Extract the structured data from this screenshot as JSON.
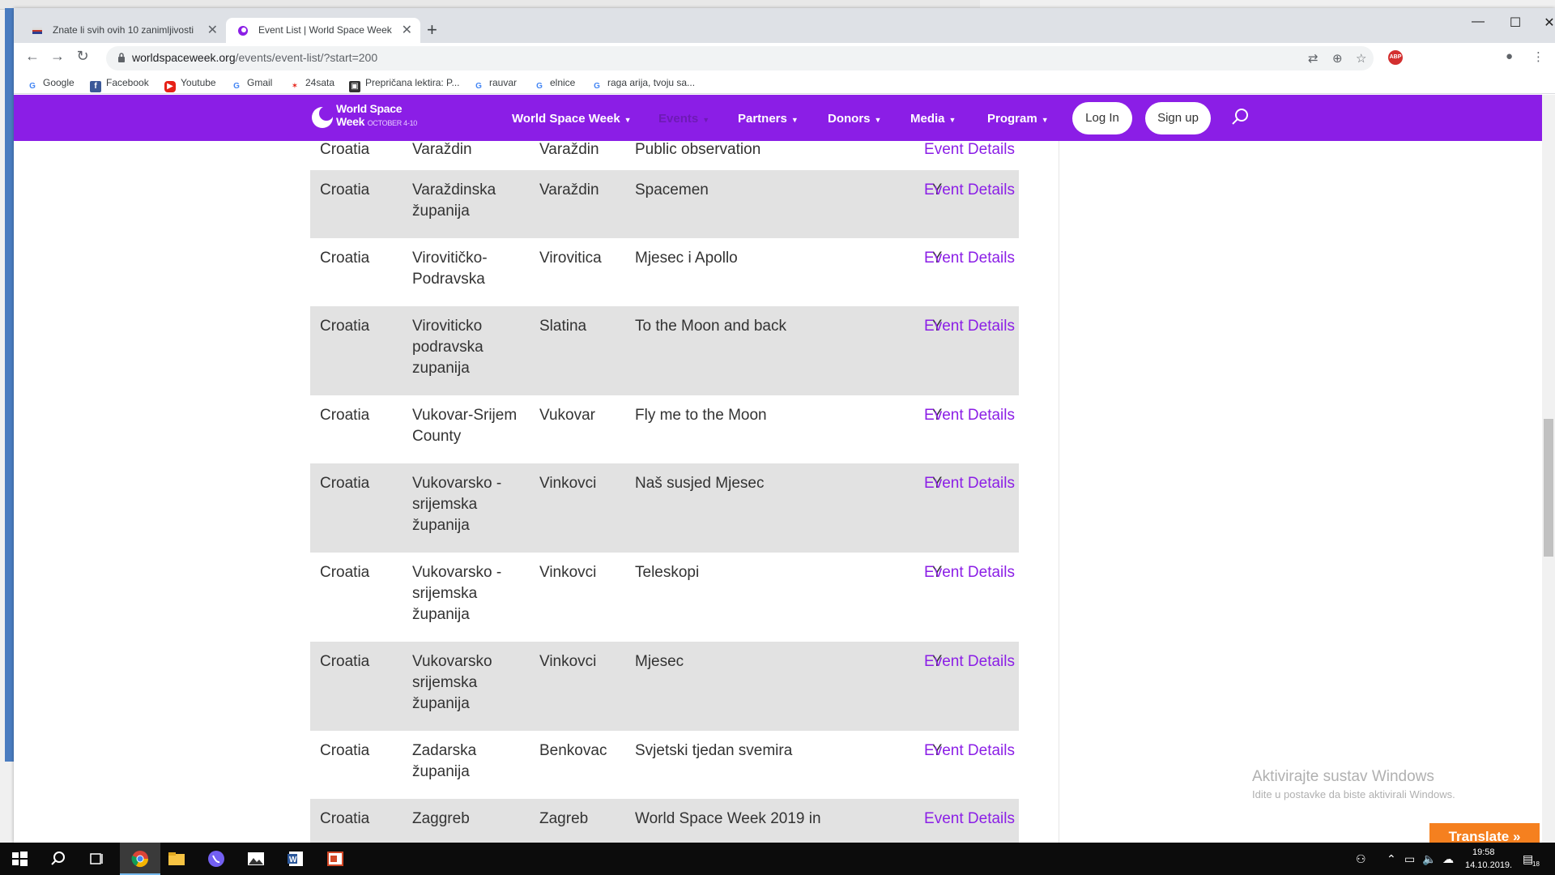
{
  "browser": {
    "tabs": [
      {
        "title": "Znate li svih ovih 10 zanimljivosti",
        "active": false
      },
      {
        "title": "Event List | World Space Week",
        "active": true
      }
    ],
    "url_domain": "worldspaceweek.org",
    "url_path": "/events/event-list/?start=200",
    "bookmarks": [
      {
        "label": "Google",
        "icon": "google-icon"
      },
      {
        "label": "Facebook",
        "icon": "facebook-icon"
      },
      {
        "label": "Youtube",
        "icon": "youtube-icon"
      },
      {
        "label": "Gmail",
        "icon": "google-icon"
      },
      {
        "label": "24sata",
        "icon": "24sata-icon"
      },
      {
        "label": "Prepričana lektira: P...",
        "icon": "book-icon"
      },
      {
        "label": "rauvar",
        "icon": "google-icon"
      },
      {
        "label": "elnice",
        "icon": "google-icon"
      },
      {
        "label": "raga arija, tvoju sa...",
        "icon": "google-icon"
      }
    ]
  },
  "site": {
    "brand_name_line1": "World Space",
    "brand_name_line2": "Week",
    "brand_date": "OCTOBER 4-10",
    "nav": {
      "world_space_week": "World Space Week",
      "events": "Events",
      "partners": "Partners",
      "donors": "Donors",
      "media": "Media",
      "program": "Program"
    },
    "login_label": "Log In",
    "signup_label": "Sign up",
    "brand_color": "#8b1ee6"
  },
  "events": [
    {
      "country": "Croatia",
      "region": "Varaždin",
      "city": "Varaždin",
      "title": "Public observation",
      "flag": "",
      "link": "Event Details"
    },
    {
      "country": "Croatia",
      "region": "Varaždinska županija",
      "city": "Varaždin",
      "title": "Spacemen",
      "flag": "Y",
      "link": "Event Details"
    },
    {
      "country": "Croatia",
      "region": "Virovitičko-Podravska",
      "city": "Virovitica",
      "title": "Mjesec i Apollo",
      "flag": "Y",
      "link": "Event Details"
    },
    {
      "country": "Croatia",
      "region": "Viroviticko podravska zupanija",
      "city": "Slatina",
      "title": "To the Moon and back",
      "flag": "Y",
      "link": "Event Details"
    },
    {
      "country": "Croatia",
      "region": "Vukovar-Srijem County",
      "city": "Vukovar",
      "title": "Fly me to the Moon",
      "flag": "Y",
      "link": "Event Details"
    },
    {
      "country": "Croatia",
      "region": "Vukovarsko - srijemska županija",
      "city": "Vinkovci",
      "title": "Naš susjed Mjesec",
      "flag": "Y",
      "link": "Event Details"
    },
    {
      "country": "Croatia",
      "region": "Vukovarsko - srijemska županija",
      "city": "Vinkovci",
      "title": "Teleskopi",
      "flag": "Y",
      "link": "Event Details"
    },
    {
      "country": "Croatia",
      "region": "Vukovarsko srijemska županija",
      "city": "Vinkovci",
      "title": "Mjesec",
      "flag": "Y",
      "link": "Event Details"
    },
    {
      "country": "Croatia",
      "region": "Zadarska županija",
      "city": "Benkovac",
      "title": "Svjetski tjedan svemira",
      "flag": "Y",
      "link": "Event Details"
    },
    {
      "country": "Croatia",
      "region": "Zaggreb",
      "city": "Zagreb",
      "title": "World Space Week 2019 in",
      "flag": "",
      "link": "Event Details"
    }
  ],
  "windows": {
    "activation_title": "Aktivirajte sustav Windows",
    "activation_sub": "Idite u postavke da biste aktivirali Windows.",
    "translate_label": "Translate »",
    "clock_time": "19:58",
    "clock_date": "14.10.2019.",
    "notification_count": "18"
  }
}
